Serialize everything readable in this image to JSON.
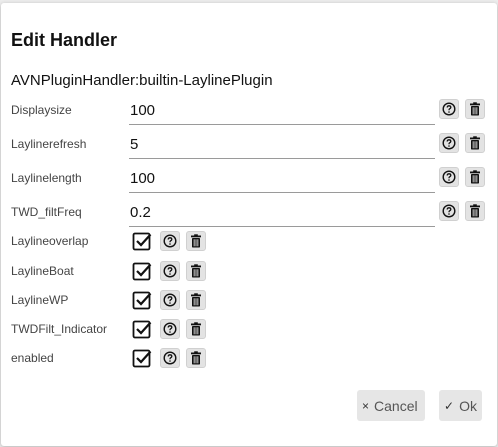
{
  "dialog": {
    "title": "Edit Handler",
    "handler_name": "AVNPluginHandler:builtin-LaylinePlugin"
  },
  "text_params": [
    {
      "label": "Displaysize",
      "value": "100"
    },
    {
      "label": "Laylinerefresh",
      "value": "5"
    },
    {
      "label": "Laylinelength",
      "value": "100"
    },
    {
      "label": "TWD_filtFreq",
      "value": "0.2"
    }
  ],
  "bool_params": [
    {
      "label": "Laylineoverlap",
      "checked": true
    },
    {
      "label": "LaylineBoat",
      "checked": true
    },
    {
      "label": "LaylineWP",
      "checked": true
    },
    {
      "label": "TWDFilt_Indicator",
      "checked": true
    },
    {
      "label": "enabled",
      "checked": true
    }
  ],
  "buttons": {
    "cancel_icon": "×",
    "cancel_label": "Cancel",
    "ok_icon": "✓",
    "ok_label": "Ok"
  },
  "icons": {
    "help": "help-icon",
    "delete": "trash-icon",
    "checkbox": "checkbox-checked-icon"
  }
}
